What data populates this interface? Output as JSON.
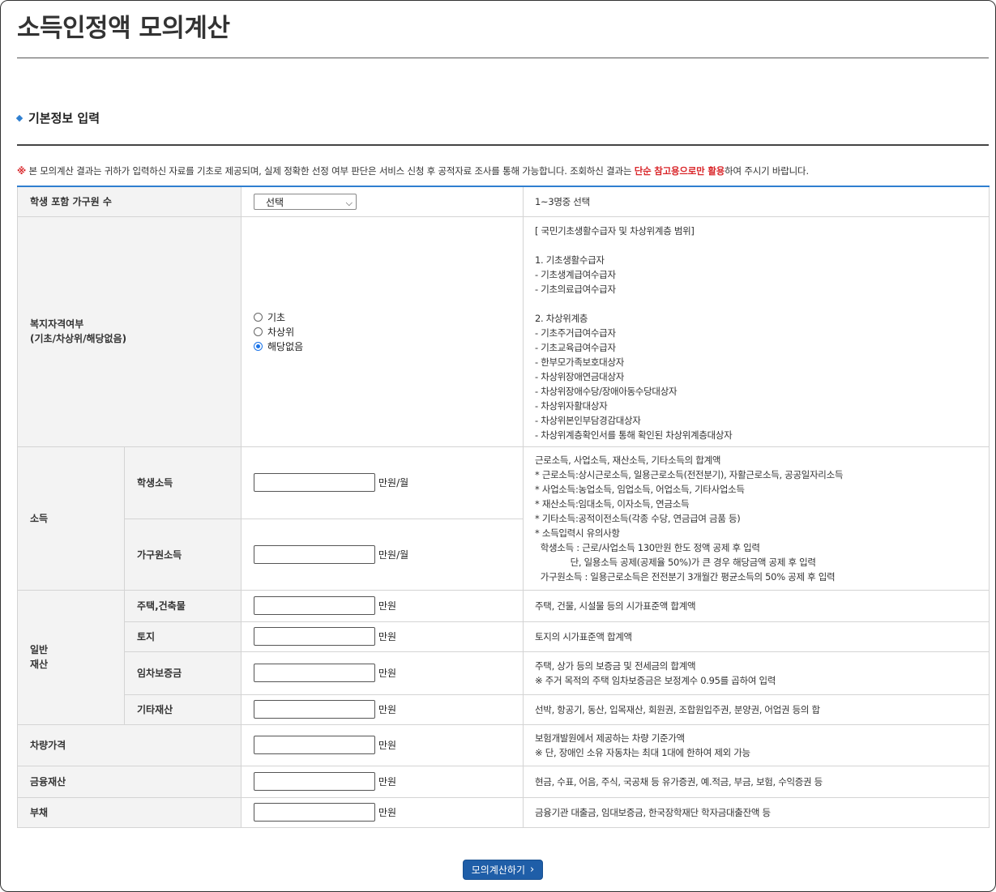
{
  "page": {
    "title": "소득인정액 모의계산"
  },
  "section": {
    "title": "기본정보 입력"
  },
  "notice": {
    "mark": "※",
    "text_before": " 본 모의계산 결과는 귀하가 입력하신 자료를 기초로 제공되며, 실제 정확한 선정 여부 판단은 서비스 신청 후 공적자료 조사를 통해 가능합니다. 조회하신 결과는 ",
    "emphasis": "단순 참고용으로만 활용",
    "text_after": "하여 주시기 바랍니다."
  },
  "household": {
    "label": "학생 포함 가구원 수",
    "select_value": "선택",
    "description": "1~3명중 선택"
  },
  "welfare": {
    "label_line1": "복지자격여부",
    "label_line2": "(기초/차상위/해당없음)",
    "options": [
      "기초",
      "차상위",
      "해당없음"
    ],
    "selected": "해당없음",
    "description": [
      "[ 국민기초생활수급자 및 차상위계층 범위]",
      "",
      "1. 기초생활수급자",
      " - 기초생계급여수급자",
      " - 기초의료급여수급자",
      "",
      "2. 차상위계층",
      " - 기초주거급여수급자",
      " - 기초교육급여수급자",
      " - 한부모가족보호대상자",
      " - 차상위장애연금대상자",
      " - 차상위장애수당/장애아동수당대상자",
      " - 차상위자활대상자",
      " - 차상위본인부담경감대상자",
      " - 차상위계층확인서를 통해 확인된 차상위계층대상자"
    ]
  },
  "income": {
    "label": "소득",
    "rows": [
      {
        "label": "학생소득",
        "unit": "만원/월",
        "value": ""
      },
      {
        "label": "가구원소득",
        "unit": "만원/월",
        "value": ""
      }
    ],
    "description": [
      "근로소득, 사업소득, 재산소득, 기타소득의 합계액",
      "* 근로소득:상시근로소득, 일용근로소득(전전분기), 자활근로소득, 공공일자리소득",
      "* 사업소득:농업소득, 임업소득, 어업소득, 기타사업소득",
      "* 재산소득:임대소득, 이자소득, 연금소득",
      "* 기타소득:공적이전소득(각종 수당, 연금급여 금품 등)",
      "* 소득입력시 유의사항",
      "  학생소득 : 근로/사업소득 130만원 한도 정액 공제 후 입력",
      "             단, 일용소득 공제(공제율 50%)가 큰 경우 해당금액 공제 후 입력",
      "  가구원소득 : 일용근로소득은 전전분기 3개월간 평균소득의 50% 공제 후 입력"
    ]
  },
  "property": {
    "label_line1": "일반",
    "label_line2": "재산",
    "rows": [
      {
        "label": "주택,건축물",
        "unit": "만원",
        "value": "",
        "description": [
          "주택, 건물, 시설물 등의 시가표준액 합계액"
        ]
      },
      {
        "label": "토지",
        "unit": "만원",
        "value": "",
        "description": [
          "토지의 시가표준액 합계액"
        ]
      },
      {
        "label": "임차보증금",
        "unit": "만원",
        "value": "",
        "description": [
          "주택, 상가 등의 보증금 및 전세금의 합계액",
          "※ 주거 목적의 주택 임차보증금은 보정계수 0.95를 곱하여 입력"
        ]
      },
      {
        "label": "기타재산",
        "unit": "만원",
        "value": "",
        "description": [
          "선박, 항공기, 동산, 입목재산, 회원권, 조합원입주권, 분양권, 어업권 등의 합"
        ]
      }
    ]
  },
  "vehicle": {
    "label": "차량가격",
    "unit": "만원",
    "value": "",
    "description": [
      "보험개발원에서 제공하는 차량 기준가액",
      "※ 단, 장애인 소유 자동차는 최대 1대에 한하여 제외 가능"
    ]
  },
  "financial": {
    "label": "금융재산",
    "unit": "만원",
    "value": "",
    "description": [
      "현금, 수표, 어음, 주식, 국공채 등 유가증권, 예.적금, 부금, 보험, 수익증권 등"
    ]
  },
  "debt": {
    "label": "부채",
    "unit": "만원",
    "value": "",
    "description": [
      "금융기관 대출금, 임대보증금, 한국장학재단 학자금대출잔액 등"
    ]
  },
  "submit": {
    "label": "모의계산하기",
    "icon": "chevron-right-icon"
  },
  "colors": {
    "accent": "#2f7fd0",
    "button": "#1f5ea8",
    "emphasis": "#d9262a"
  }
}
